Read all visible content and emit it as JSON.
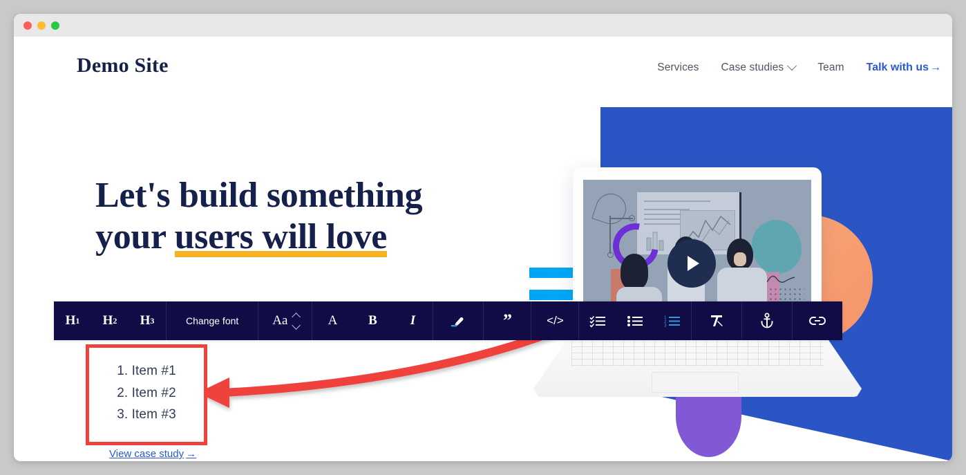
{
  "window": {
    "traffic_lights": [
      "close",
      "minimize",
      "maximize"
    ]
  },
  "header": {
    "brand": "Demo Site",
    "nav": [
      {
        "label": "Services",
        "has_caret": false
      },
      {
        "label": "Case studies",
        "has_caret": true
      },
      {
        "label": "Team",
        "has_caret": false
      }
    ],
    "cta": "Talk with us",
    "cta_arrow": "→"
  },
  "hero": {
    "line1": "Let's build something",
    "line2_plain": "your ",
    "line2_highlight": "users will love",
    "highlight_color": "#f8b324",
    "case_link": "View case study",
    "case_link_arrow": "→"
  },
  "toolbar": {
    "background": "#110c46",
    "active_color": "#2d9cdb",
    "groups": [
      {
        "name": "headings",
        "buttons": [
          {
            "name": "heading-1-button",
            "label": "H",
            "sub": "1",
            "kind": "heading"
          },
          {
            "name": "heading-2-button",
            "label": "H",
            "sub": "2",
            "kind": "heading"
          },
          {
            "name": "heading-3-button",
            "label": "H",
            "sub": "3",
            "kind": "heading"
          }
        ]
      },
      {
        "name": "font-family",
        "buttons": [
          {
            "name": "change-font-button",
            "label": "Change font",
            "kind": "text"
          }
        ]
      },
      {
        "name": "font-size",
        "buttons": [
          {
            "name": "font-size-stepper",
            "label": "Aa",
            "kind": "stepper"
          }
        ]
      },
      {
        "name": "text-style",
        "buttons": [
          {
            "name": "text-color-button",
            "label": "A",
            "kind": "letter"
          },
          {
            "name": "bold-button",
            "label": "B",
            "kind": "bold"
          },
          {
            "name": "italic-button",
            "label": "I",
            "kind": "italic"
          }
        ]
      },
      {
        "name": "highlight",
        "buttons": [
          {
            "name": "highlighter-pen-icon",
            "kind": "icon"
          }
        ]
      },
      {
        "name": "blockquote",
        "buttons": [
          {
            "name": "blockquote-button",
            "label": "”",
            "kind": "quote"
          }
        ]
      },
      {
        "name": "code",
        "buttons": [
          {
            "name": "code-block-button",
            "label": "</>",
            "kind": "code"
          }
        ]
      },
      {
        "name": "lists",
        "buttons": [
          {
            "name": "checklist-button",
            "kind": "icon",
            "active": false
          },
          {
            "name": "bulleted-list-button",
            "kind": "icon",
            "active": false
          },
          {
            "name": "numbered-list-button",
            "kind": "icon",
            "active": true
          }
        ]
      },
      {
        "name": "clear-formatting",
        "buttons": [
          {
            "name": "clear-formatting-icon",
            "kind": "icon"
          }
        ]
      },
      {
        "name": "anchor",
        "buttons": [
          {
            "name": "anchor-icon",
            "kind": "icon"
          }
        ]
      },
      {
        "name": "link",
        "buttons": [
          {
            "name": "insert-link-icon",
            "kind": "icon"
          }
        ]
      }
    ]
  },
  "annotation": {
    "box_border_color": "#f0423c",
    "arrow_color": "#f0423c",
    "list_items": [
      "1. Item #1",
      "2. Item #2",
      "3. Item #3"
    ]
  },
  "artwork": {
    "blue_block_color": "#2b55c4",
    "orange_circle_color": "#f4956a",
    "purple_arc_color": "#8158d6",
    "cyan_bar_color": "#00a4f5",
    "screen_bg_color": "#94a3b5",
    "play_button_color": "#1f2d50"
  }
}
